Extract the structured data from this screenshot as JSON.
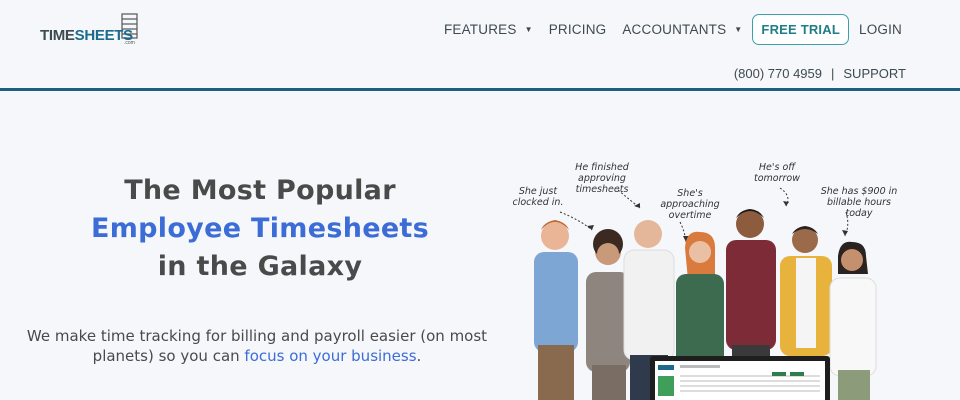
{
  "brand": {
    "name_part1": "TIME",
    "name_part2": "SHEETS",
    "suffix": ".com"
  },
  "nav": {
    "items": [
      {
        "label": "FEATURES",
        "has_caret": true
      },
      {
        "label": "PRICING",
        "has_caret": false
      },
      {
        "label": "ACCOUNTANTS",
        "has_caret": true
      }
    ],
    "cta_label": "FREE TRIAL",
    "login_label": "LOGIN",
    "phone": "(800) 770 4959",
    "separator": "|",
    "support_label": "SUPPORT"
  },
  "hero": {
    "title_line1": "The Most Popular",
    "title_line2": "Employee Timesheets",
    "title_line3": "in the Galaxy",
    "subtitle_text": "We make time tracking for billing and payroll easier (on most planets) so you can ",
    "subtitle_link": "focus on your business",
    "subtitle_end": "."
  },
  "callouts": {
    "c1": "She just clocked in.",
    "c2": "He finished approving timesheets",
    "c3": "She's approaching overtime",
    "c4": "He's off tomorrow",
    "c5": "She has $900 in billable hours today"
  },
  "colors": {
    "accent": "#3c6cd6",
    "brand": "#1c6a8c",
    "rule": "#1d5f7e",
    "cta": "#1f7e86"
  }
}
